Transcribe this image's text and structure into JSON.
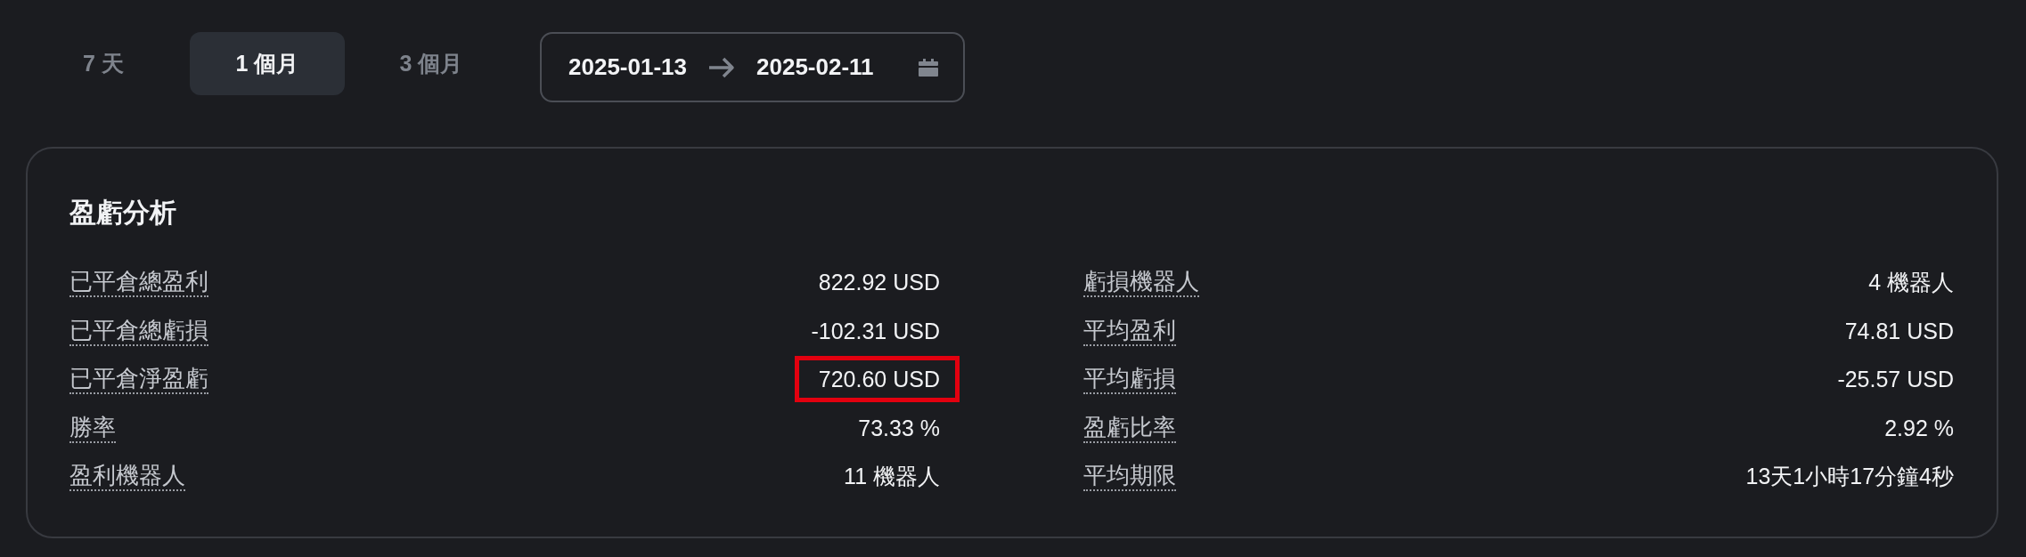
{
  "period_tabs": [
    {
      "label": "7 天",
      "selected": false
    },
    {
      "label": "1 個月",
      "selected": true
    },
    {
      "label": "3 個月",
      "selected": false
    }
  ],
  "date_range": {
    "start": "2025-01-13",
    "end": "2025-02-11"
  },
  "pnl_card": {
    "title": "盈虧分析",
    "columns": [
      {
        "items": [
          {
            "label": "已平倉總盈利",
            "value": "822.92 USD",
            "highlighted": false
          },
          {
            "label": "已平倉總虧損",
            "value": "-102.31 USD",
            "highlighted": false
          },
          {
            "label": "已平倉淨盈虧",
            "value": "720.60 USD",
            "highlighted": true
          },
          {
            "label": "勝率",
            "value": "73.33 %",
            "highlighted": false
          },
          {
            "label": "盈利機器人",
            "value": "11 機器人",
            "highlighted": false
          }
        ]
      },
      {
        "items": [
          {
            "label": "虧損機器人",
            "value": "4 機器人",
            "highlighted": false
          },
          {
            "label": "平均盈利",
            "value": "74.81 USD",
            "highlighted": false
          },
          {
            "label": "平均虧損",
            "value": "-25.57 USD",
            "highlighted": false
          },
          {
            "label": "盈虧比率",
            "value": "2.92 %",
            "highlighted": false
          },
          {
            "label": "平均期限",
            "value": "13天1小時17分鐘4秒",
            "highlighted": false
          }
        ]
      }
    ]
  }
}
